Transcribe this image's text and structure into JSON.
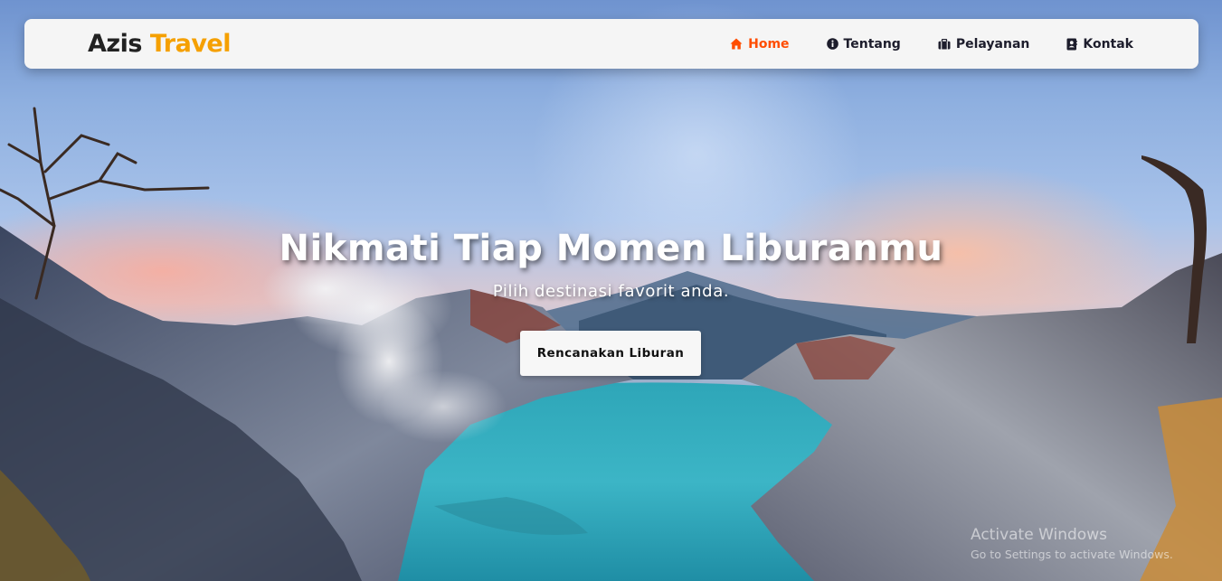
{
  "brand": {
    "name": "Azis",
    "accent": "Travel",
    "accent_color": "#f5a000"
  },
  "nav": {
    "items": [
      {
        "label": "Home",
        "icon": "home-icon",
        "active": true
      },
      {
        "label": "Tentang",
        "icon": "info-circle-icon",
        "active": false
      },
      {
        "label": "Pelayanan",
        "icon": "briefcase-icon",
        "active": false
      },
      {
        "label": "Kontak",
        "icon": "address-book-icon",
        "active": false
      }
    ],
    "active_color": "#ff4d00"
  },
  "hero": {
    "title": "Nikmati Tiap Momen Liburanmu",
    "subtitle": "Pilih destinasi favorit anda.",
    "cta_label": "Rencanakan Liburan"
  },
  "watermark": {
    "line1": "Activate Windows",
    "line2": "Go to Settings to activate Windows."
  }
}
